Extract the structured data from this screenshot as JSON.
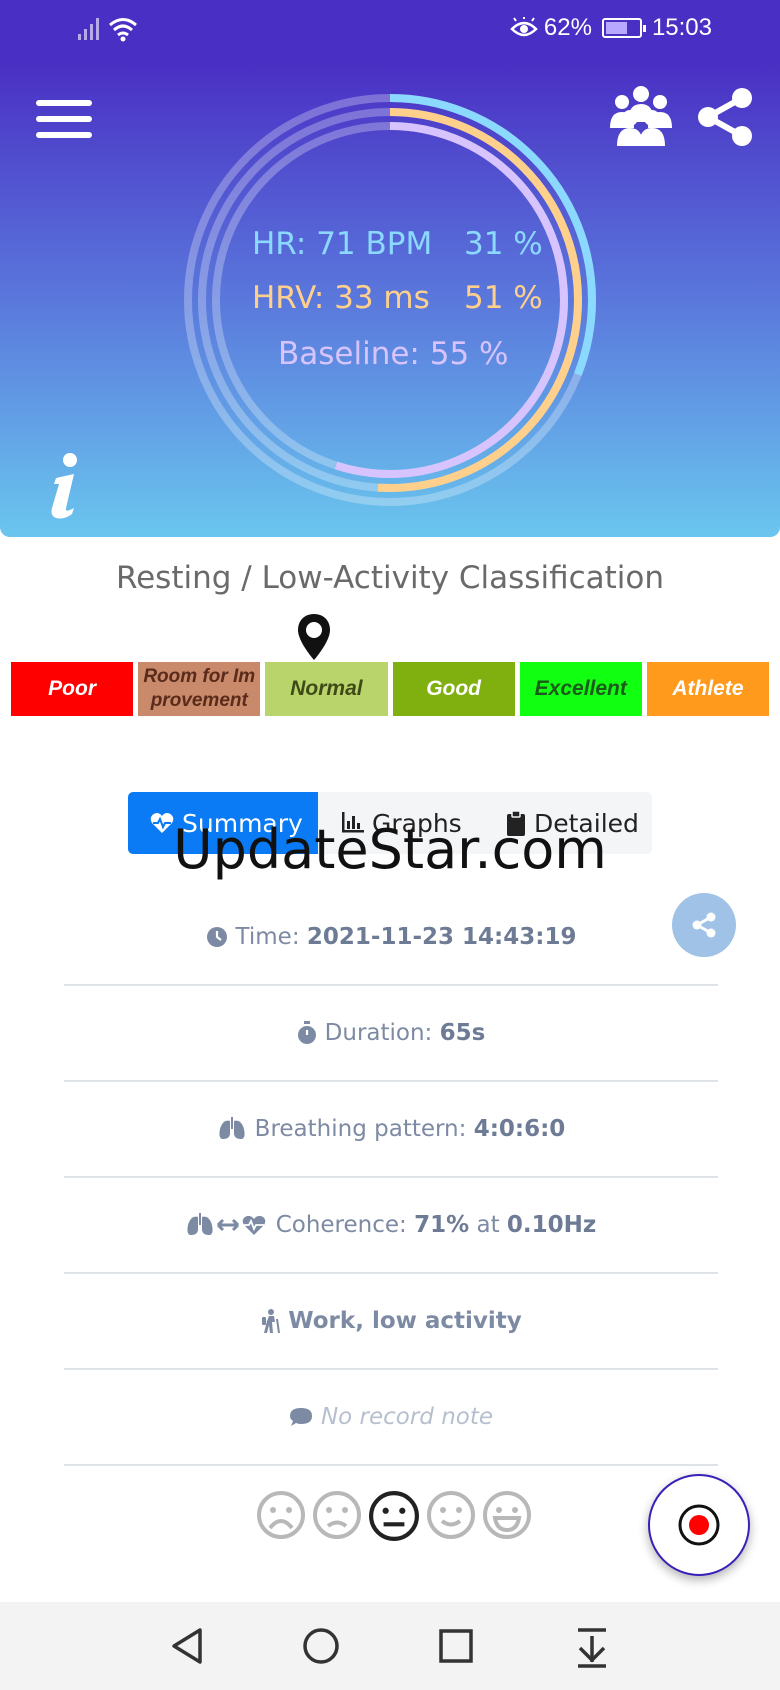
{
  "status_bar": {
    "battery": "62%",
    "time": "15:03",
    "battery_level": 0.62
  },
  "ring": {
    "hr_label": "HR: 71 BPM",
    "hr_pct": "31 %",
    "hrv_label": "HRV: 33 ms",
    "hrv_pct": "51 %",
    "baseline_label": "Baseline: 55 %",
    "colors": {
      "hr": "#8cd9ff",
      "hrv": "#ffd08c",
      "baseline": "#d7c4ff"
    }
  },
  "classification": {
    "title": "Resting / Low-Activity Classification",
    "segments": [
      {
        "label": "Poor",
        "color": "#ff0000"
      },
      {
        "label": "Room for Im provement",
        "color": "#c98a6c"
      },
      {
        "label": "Normal",
        "color": "#b9d46a"
      },
      {
        "label": "Good",
        "color": "#7fb010"
      },
      {
        "label": "Excellent",
        "color": "#11ff11"
      },
      {
        "label": "Athlete",
        "color": "#ff9a1c"
      }
    ],
    "selected": "Normal"
  },
  "tabs": {
    "summary": "Summary",
    "graphs": "Graphs",
    "detailed": "Detailed",
    "active": "Summary"
  },
  "watermark": "UpdateStar.com",
  "details": {
    "time_label": "Time:",
    "time_value": "2021-11-23 14:43:19",
    "duration_label": "Duration:",
    "duration_value": "65s",
    "breathing_label": "Breathing pattern:",
    "breathing_value": "4:0:6:0",
    "coherence_label": "Coherence:",
    "coherence_value": "71%",
    "coherence_at": "at",
    "coherence_freq": "0.10Hz",
    "activity": "Work, low activity",
    "note": "No record note"
  },
  "mood": {
    "selected": "neutral"
  },
  "accent": "#0a7bf5"
}
